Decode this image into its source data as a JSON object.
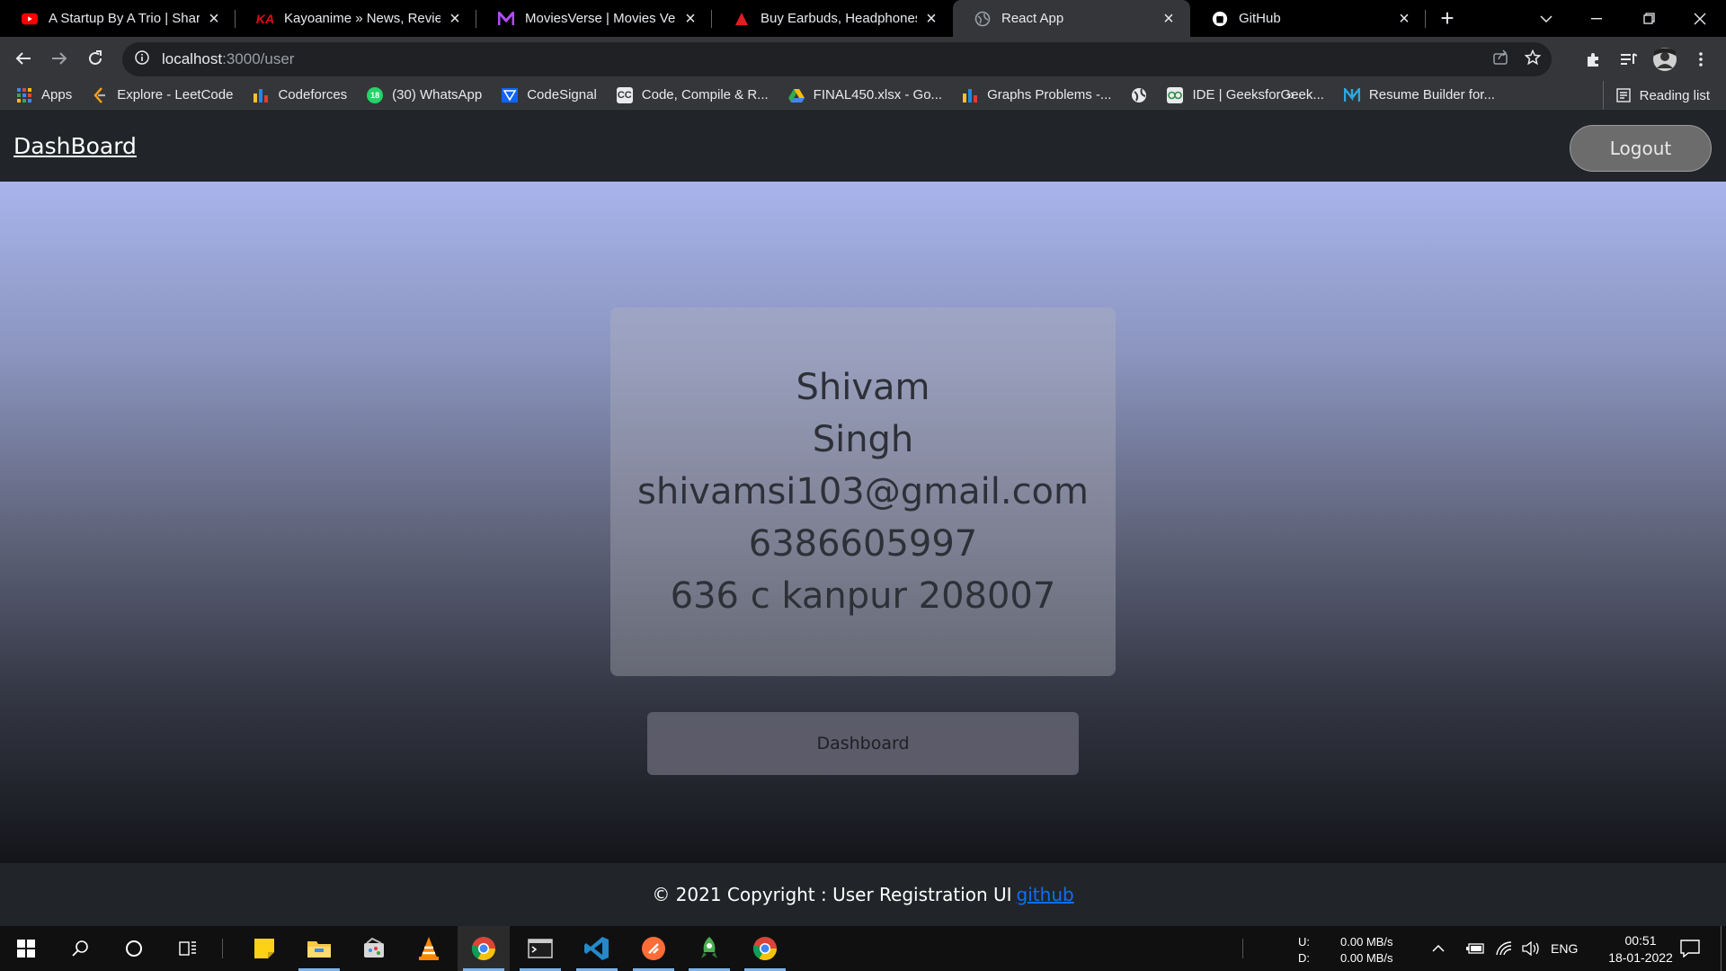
{
  "browser": {
    "tabs": [
      {
        "title": "A Startup By A Trio | Shark Tank",
        "icon": "youtube-icon",
        "color": "#ff0000"
      },
      {
        "title": "Kayoanime » News, Reviews",
        "icon": "ka-icon",
        "color": "#e50914"
      },
      {
        "title": "MoviesVerse | Movies Verse",
        "icon": "m-icon",
        "color": "#b14cf3"
      },
      {
        "title": "Buy Earbuds, Headphones,",
        "icon": "boat-icon",
        "color": "#e31b23"
      },
      {
        "title": "React App",
        "icon": "globe-icon",
        "color": "#9aa0a6"
      },
      {
        "title": "GitHub",
        "icon": "github-icon",
        "color": "#ffffff"
      }
    ],
    "active_tab": 4,
    "url_host": "localhost",
    "url_path": ":3000/user",
    "bookmarks": [
      {
        "label": "Apps",
        "icon": "apps-grid-icon"
      },
      {
        "label": "Explore - LeetCode",
        "icon": "leetcode-icon"
      },
      {
        "label": "Codeforces",
        "icon": "codeforces-icon"
      },
      {
        "label": "(30) WhatsApp",
        "icon": "whatsapp-icon",
        "badge": "18"
      },
      {
        "label": "CodeSignal",
        "icon": "codesignal-icon"
      },
      {
        "label": "Code, Compile & R...",
        "icon": "cc-icon",
        "badge": "CC"
      },
      {
        "label": "FINAL450.xlsx - Go...",
        "icon": "google-drive-icon"
      },
      {
        "label": "Graphs Problems -...",
        "icon": "bars-icon"
      },
      {
        "label": "",
        "icon": "globe-icon"
      },
      {
        "label": "IDE | GeeksforGeek...",
        "icon": "gfg-icon"
      },
      {
        "label": "Resume Builder for...",
        "icon": "resume-icon"
      }
    ],
    "bookmarks_more": "»",
    "reading_list": "Reading list"
  },
  "app": {
    "brand": "DashBoard",
    "logout_label": "Logout",
    "user": {
      "first_name": "Shivam",
      "last_name": "Singh",
      "email": "shivamsi103@gmail.com",
      "phone": "6386605997",
      "address": "636 c kanpur 208007"
    },
    "dashboard_button": "Dashboard",
    "footer_text": "© 2021 Copyright : User Registration UI",
    "footer_link": "github"
  },
  "taskbar": {
    "net_up_label": "U:",
    "net_down_label": "D:",
    "net_up": "0.00 MB/s",
    "net_down": "0.00 MB/s",
    "language": "ENG",
    "time": "00:51",
    "date": "18-01-2022"
  },
  "colors": {
    "footer_link": "#0d6efd",
    "navbar": "#212529",
    "gradient_top": "#a8b4ec",
    "gradient_bottom": "#14151a"
  }
}
